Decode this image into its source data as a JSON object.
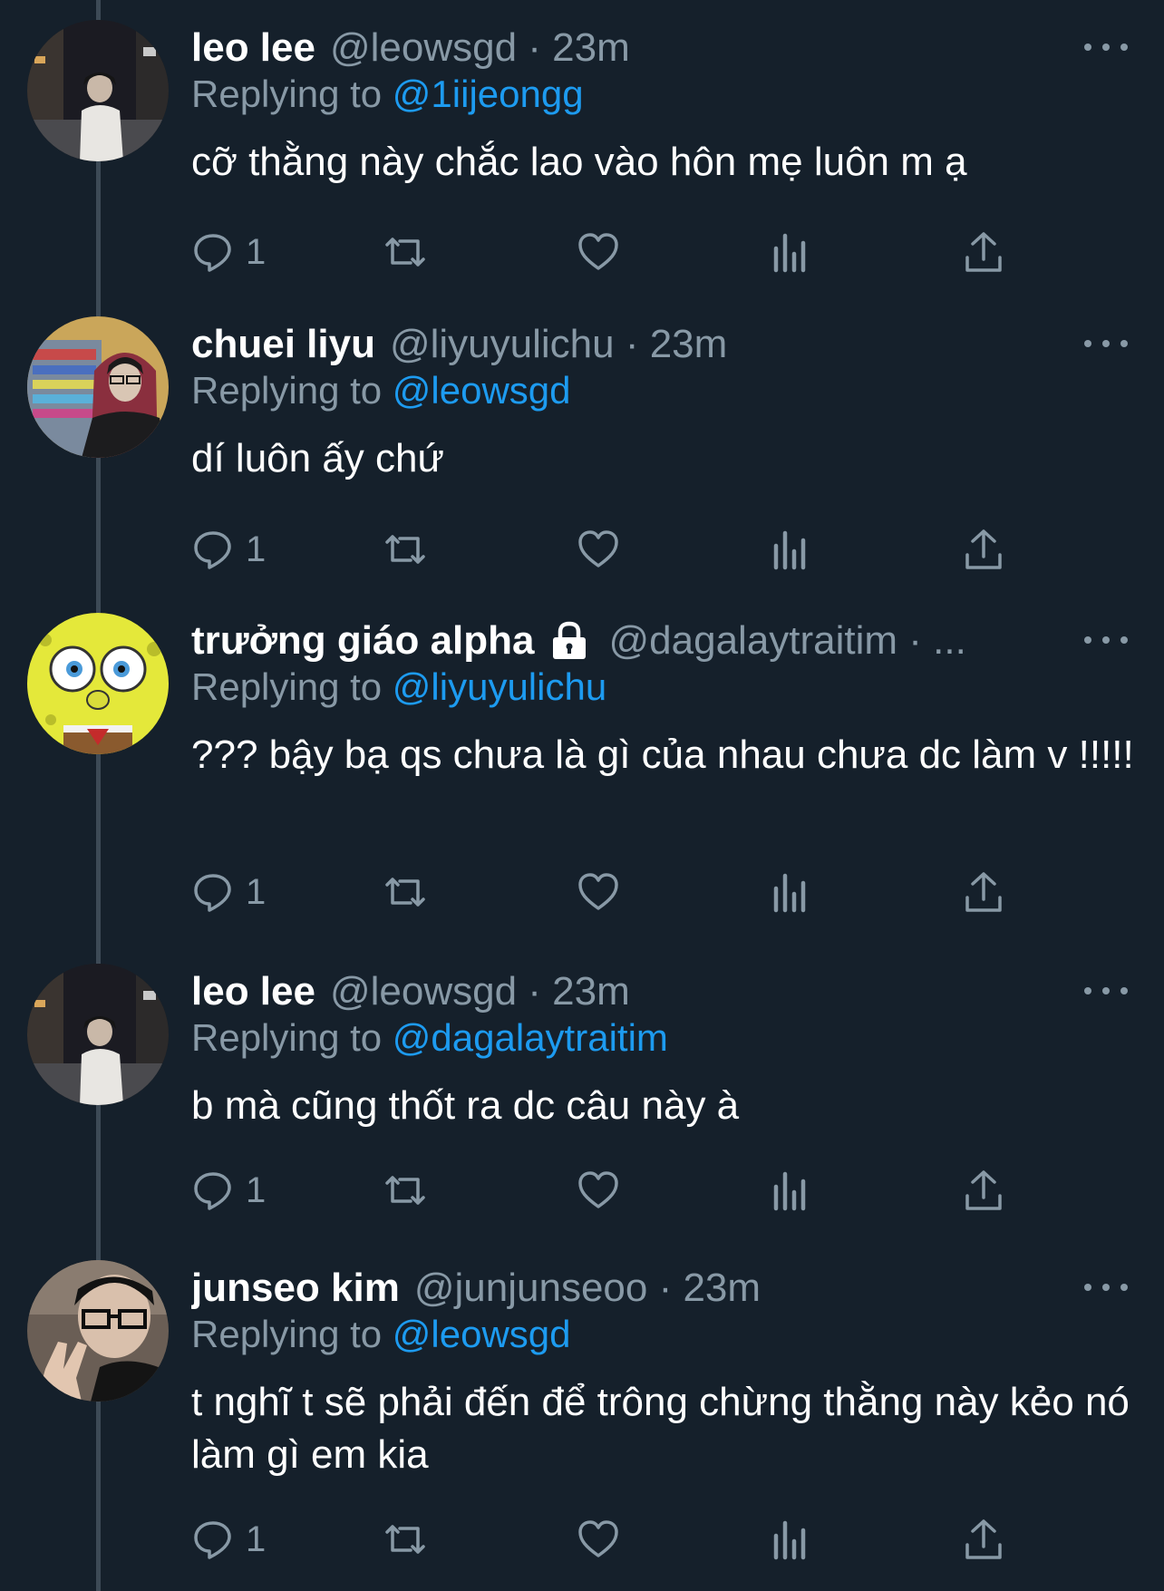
{
  "colors": {
    "background": "#15202b",
    "secondary_text": "#8899a6",
    "mention": "#1d9bf0",
    "thread_line": "#3d4a56"
  },
  "tweets": [
    {
      "name": "leo lee",
      "handle_time": "@leowsgd · 23m",
      "replying_label": "Replying to",
      "mention": "@1iijeongg",
      "text": "cỡ thằng này chắc lao vào hôn mẹ luôn m ạ",
      "reply_count": "1",
      "avatar": "photo-person-night-street"
    },
    {
      "name": "chuei liyu",
      "handle_time": "@liyuyulichu · 23m",
      "replying_label": "Replying to",
      "mention": "@leowsgd",
      "text": "dí luôn ấy chứ",
      "reply_count": "1",
      "avatar": "photo-person-red-hoodie"
    },
    {
      "name": "trưởng giáo alpha",
      "handle_time": "@dagalaytraitim · ...",
      "replying_label": "Replying to",
      "mention": "@liyuyulichu",
      "text": "??? bậy bạ qs chưa là gì của nhau chưa dc làm v !!!!!",
      "reply_count": "1",
      "avatar": "cartoon-yellow-sponge",
      "locked": true
    },
    {
      "name": "leo lee",
      "handle_time": "@leowsgd · 23m",
      "replying_label": "Replying to",
      "mention": "@dagalaytraitim",
      "text": "b mà cũng thốt ra dc câu này à",
      "reply_count": "1",
      "avatar": "photo-person-night-street"
    },
    {
      "name": "junseo kim",
      "handle_time": "@junjunseoo · 23m",
      "replying_label": "Replying to",
      "mention": "@leowsgd",
      "text": "t nghĩ t sẽ phải đến để trông chừng thằng này kẻo nó làm gì em kia",
      "reply_count": "1",
      "avatar": "photo-person-glasses-peace-sign"
    }
  ]
}
